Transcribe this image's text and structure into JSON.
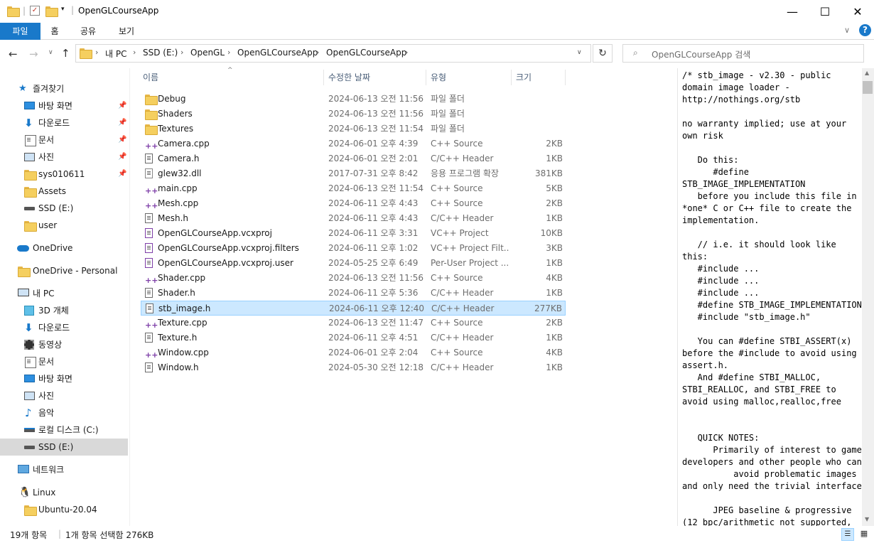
{
  "window": {
    "title": "OpenGLCourseApp",
    "minimize": "—",
    "maximize": "☐",
    "close": "✕"
  },
  "ribbon": {
    "tabs": [
      "파일",
      "홈",
      "공유",
      "보기"
    ]
  },
  "address": {
    "crumbs": [
      "내 PC",
      "SSD (E:)",
      "OpenGL",
      "OpenGLCourseApp",
      "OpenGLCourseApp"
    ],
    "search_placeholder": "OpenGLCourseApp 검색"
  },
  "sidebar": {
    "items": [
      {
        "label": "즐겨찾기",
        "icon": "star-icon"
      },
      {
        "label": "바탕 화면",
        "icon": "desktop-icon",
        "pinned": true
      },
      {
        "label": "다운로드",
        "icon": "download-icon",
        "pinned": true
      },
      {
        "label": "문서",
        "icon": "document-icon",
        "pinned": true
      },
      {
        "label": "사진",
        "icon": "pictures-icon",
        "pinned": true
      },
      {
        "label": "sys010611",
        "icon": "folder-icon",
        "pinned": true
      },
      {
        "label": "Assets",
        "icon": "folder-icon"
      },
      {
        "label": "SSD (E:)",
        "icon": "drive-icon"
      },
      {
        "label": "user",
        "icon": "folder-icon"
      },
      {
        "label": "OneDrive",
        "icon": "cloud-icon"
      },
      {
        "label": "OneDrive - Personal",
        "icon": "folder-icon"
      },
      {
        "label": "내 PC",
        "icon": "pc-icon"
      },
      {
        "label": "3D 개체",
        "icon": "3d-objects-icon"
      },
      {
        "label": "다운로드",
        "icon": "download-icon"
      },
      {
        "label": "동영상",
        "icon": "video-icon"
      },
      {
        "label": "문서",
        "icon": "document-icon"
      },
      {
        "label": "바탕 화면",
        "icon": "desktop-icon"
      },
      {
        "label": "사진",
        "icon": "pictures-icon"
      },
      {
        "label": "음악",
        "icon": "music-icon"
      },
      {
        "label": "로컬 디스크 (C:)",
        "icon": "drive-icon"
      },
      {
        "label": "SSD (E:)",
        "icon": "drive-icon",
        "selected": true
      },
      {
        "label": "네트워크",
        "icon": "network-icon"
      },
      {
        "label": "Linux",
        "icon": "linux-icon"
      },
      {
        "label": "Ubuntu-20.04",
        "icon": "folder-icon"
      }
    ]
  },
  "columns": {
    "name": "이름",
    "date": "수정한 날짜",
    "type": "유형",
    "size": "크기"
  },
  "files": [
    {
      "name": "Debug",
      "date": "2024-06-13 오전 11:56",
      "type": "파일 폴더",
      "size": "",
      "kind": "folder"
    },
    {
      "name": "Shaders",
      "date": "2024-06-13 오전 11:56",
      "type": "파일 폴더",
      "size": "",
      "kind": "folder"
    },
    {
      "name": "Textures",
      "date": "2024-06-13 오전 11:54",
      "type": "파일 폴더",
      "size": "",
      "kind": "folder"
    },
    {
      "name": "Camera.cpp",
      "date": "2024-06-01 오후 4:39",
      "type": "C++ Source",
      "size": "2KB",
      "kind": "cpp"
    },
    {
      "name": "Camera.h",
      "date": "2024-06-01 오전 2:01",
      "type": "C/C++ Header",
      "size": "1KB",
      "kind": "h"
    },
    {
      "name": "glew32.dll",
      "date": "2017-07-31 오후 8:42",
      "type": "응용 프로그램 확장",
      "size": "381KB",
      "kind": "dll"
    },
    {
      "name": "main.cpp",
      "date": "2024-06-13 오전 11:54",
      "type": "C++ Source",
      "size": "5KB",
      "kind": "cpp"
    },
    {
      "name": "Mesh.cpp",
      "date": "2024-06-11 오후 4:43",
      "type": "C++ Source",
      "size": "2KB",
      "kind": "cpp"
    },
    {
      "name": "Mesh.h",
      "date": "2024-06-11 오후 4:43",
      "type": "C/C++ Header",
      "size": "1KB",
      "kind": "h"
    },
    {
      "name": "OpenGLCourseApp.vcxproj",
      "date": "2024-06-11 오후 3:31",
      "type": "VC++ Project",
      "size": "10KB",
      "kind": "proj"
    },
    {
      "name": "OpenGLCourseApp.vcxproj.filters",
      "date": "2024-06-11 오후 1:02",
      "type": "VC++ Project Filt...",
      "size": "3KB",
      "kind": "filters"
    },
    {
      "name": "OpenGLCourseApp.vcxproj.user",
      "date": "2024-05-25 오후 6:49",
      "type": "Per-User Project ...",
      "size": "1KB",
      "kind": "user"
    },
    {
      "name": "Shader.cpp",
      "date": "2024-06-13 오전 11:56",
      "type": "C++ Source",
      "size": "4KB",
      "kind": "cpp"
    },
    {
      "name": "Shader.h",
      "date": "2024-06-11 오후 5:36",
      "type": "C/C++ Header",
      "size": "1KB",
      "kind": "h"
    },
    {
      "name": "stb_image.h",
      "date": "2024-06-11 오후 12:40",
      "type": "C/C++ Header",
      "size": "277KB",
      "kind": "h",
      "selected": true
    },
    {
      "name": "Texture.cpp",
      "date": "2024-06-13 오전 11:47",
      "type": "C++ Source",
      "size": "2KB",
      "kind": "cpp"
    },
    {
      "name": "Texture.h",
      "date": "2024-06-11 오후 4:51",
      "type": "C/C++ Header",
      "size": "1KB",
      "kind": "h"
    },
    {
      "name": "Window.cpp",
      "date": "2024-06-01 오후 2:04",
      "type": "C++ Source",
      "size": "4KB",
      "kind": "cpp"
    },
    {
      "name": "Window.h",
      "date": "2024-05-30 오전 12:18",
      "type": "C/C++ Header",
      "size": "1KB",
      "kind": "h"
    }
  ],
  "preview": {
    "text": "/* stb_image - v2.30 - public\ndomain image loader -\nhttp://nothings.org/stb\n\nno warranty implied; use at your\nown risk\n\n   Do this:\n      #define\nSTB_IMAGE_IMPLEMENTATION\n   before you include this file in\n*one* C or C++ file to create the\nimplementation.\n\n   // i.e. it should look like\nthis:\n   #include ...\n   #include ...\n   #include ...\n   #define STB_IMAGE_IMPLEMENTATION\n   #include \"stb_image.h\"\n\n   You can #define STBI_ASSERT(x)\nbefore the #include to avoid using\nassert.h.\n   And #define STBI_MALLOC,\nSTBI_REALLOC, and STBI_FREE to\navoid using malloc,realloc,free\n\n\n   QUICK NOTES:\n      Primarily of interest to game\ndevelopers and other people who can\n          avoid problematic images\nand only need the trivial interface\n\n      JPEG baseline & progressive\n(12 bpc/arithmetic not supported,"
  },
  "status": {
    "count": "19개 항목",
    "selection": "1개 항목 선택함 276KB"
  }
}
